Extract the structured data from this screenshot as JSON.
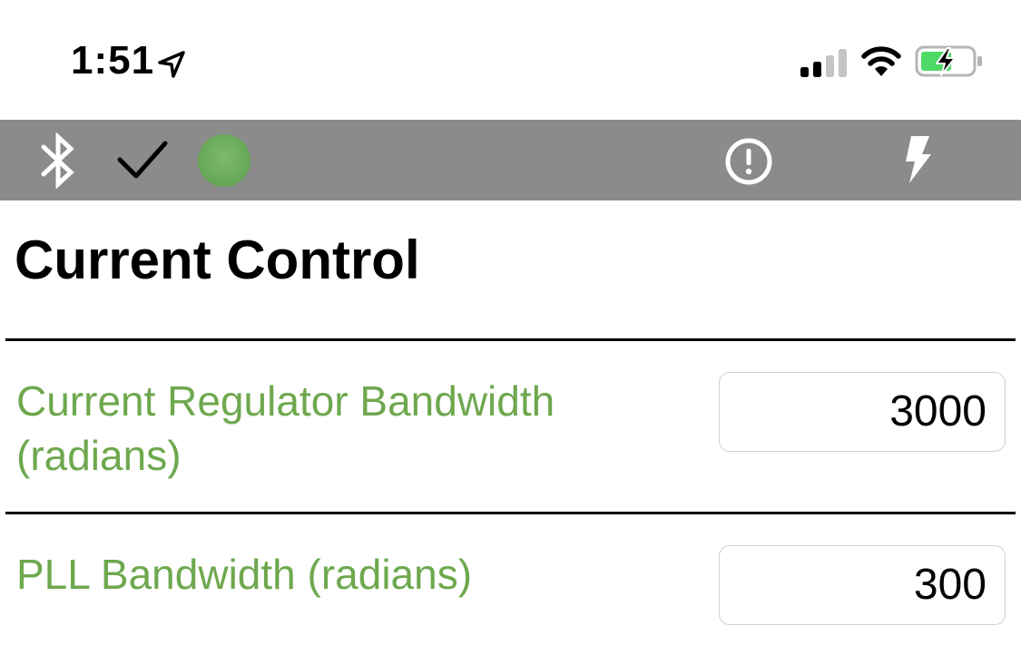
{
  "status_bar": {
    "time": "1:51",
    "icons": [
      "location-arrow-icon",
      "cellular-signal-icon",
      "wifi-icon",
      "battery-charging-icon"
    ]
  },
  "toolbar": {
    "icons": [
      "bluetooth-icon",
      "checkmark-icon",
      "connection-status-dot",
      "alert-icon",
      "lightning-bolt-icon"
    ],
    "status_color": "#6aab5a",
    "background": "#8b8b8b"
  },
  "page": {
    "title": "Current Control"
  },
  "fields": [
    {
      "label": "Current Regulator Bandwidth (radians)",
      "value": "3000"
    },
    {
      "label": "PLL Bandwidth (radians)",
      "value": "300"
    }
  ],
  "colors": {
    "label": "#6ea84e",
    "battery_fill": "#4cd964"
  }
}
